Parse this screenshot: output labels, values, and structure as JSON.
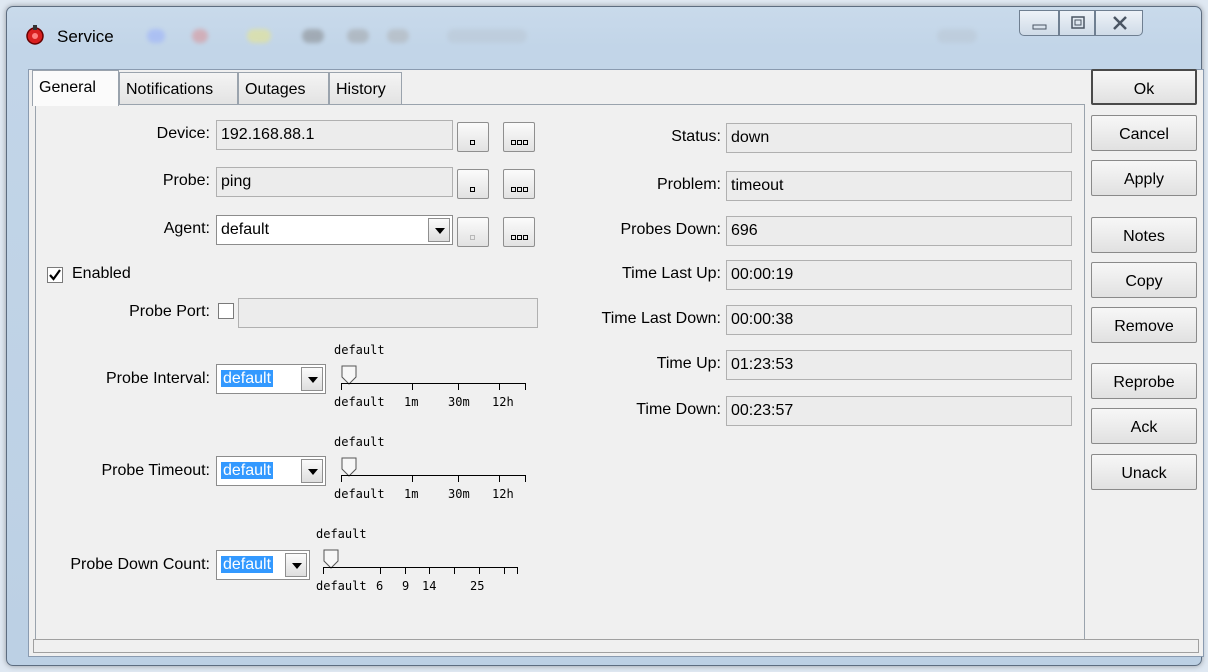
{
  "window": {
    "title": "Service",
    "blurred_title_text": "Status"
  },
  "tabs": [
    "General",
    "Notifications",
    "Outages",
    "History"
  ],
  "left": {
    "device": {
      "label": "Device:",
      "value": "192.168.88.1"
    },
    "probe": {
      "label": "Probe:",
      "value": "ping"
    },
    "agent": {
      "label": "Agent:",
      "value": "default"
    },
    "enabled": {
      "label": "Enabled",
      "checked": true
    },
    "probe_port": {
      "label": "Probe Port:",
      "value": ""
    },
    "probe_interval": {
      "label": "Probe Interval:",
      "value": "default",
      "slider_caption": "default",
      "ticks": [
        "default",
        "1m",
        "30m",
        "12h"
      ]
    },
    "probe_timeout": {
      "label": "Probe Timeout:",
      "value": "default",
      "slider_caption": "default",
      "ticks": [
        "default",
        "1m",
        "30m",
        "12h"
      ]
    },
    "probe_down_count": {
      "label": "Probe Down Count:",
      "value": "default",
      "slider_caption": "default",
      "ticks": [
        "default",
        "6",
        "9",
        "14",
        "25"
      ]
    }
  },
  "right": [
    {
      "label": "Status:",
      "value": "down"
    },
    {
      "label": "Problem:",
      "value": "timeout"
    },
    {
      "label": "Probes Down:",
      "value": "696"
    },
    {
      "label": "Time Last Up:",
      "value": "00:00:19"
    },
    {
      "label": "Time Last Down:",
      "value": "00:00:38"
    },
    {
      "label": "Time Up:",
      "value": "01:23:53"
    },
    {
      "label": "Time Down:",
      "value": "00:23:57"
    }
  ],
  "buttons": [
    "Ok",
    "Cancel",
    "Apply",
    "Notes",
    "Copy",
    "Remove",
    "Reprobe",
    "Ack",
    "Unack"
  ],
  "colors": {
    "selection": "#3399ff",
    "app_icon": "#d91f1f"
  }
}
